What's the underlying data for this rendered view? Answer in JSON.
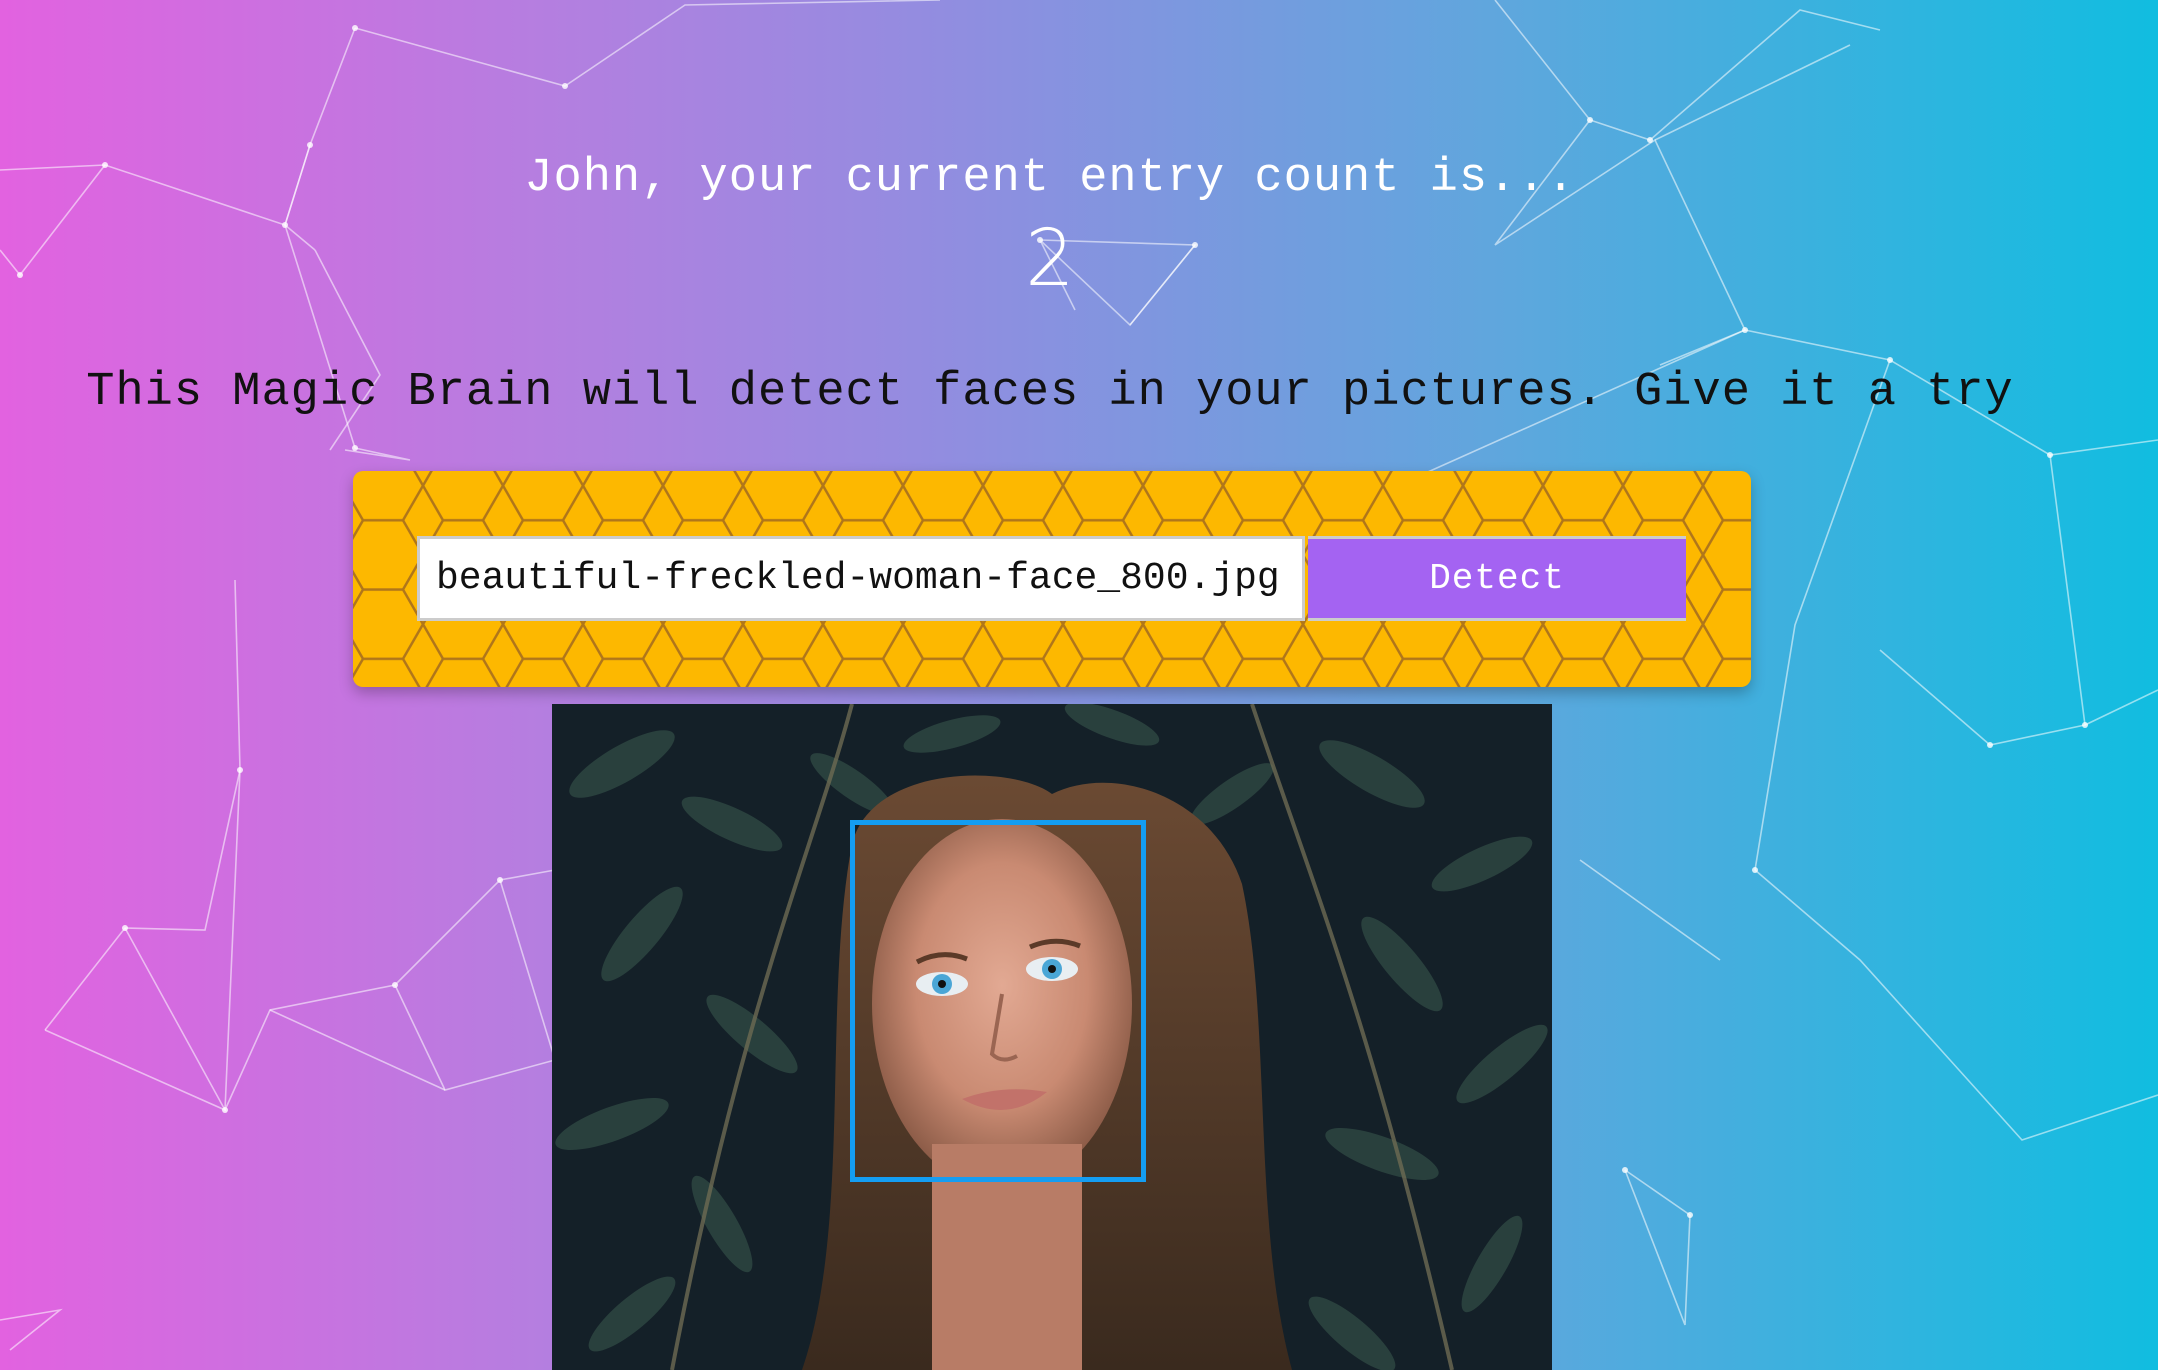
{
  "app": {
    "greeting": "John, your current entry count is...",
    "entry_count": "2",
    "intro": "This Magic Brain will detect faces in your pictures. Give it a try"
  },
  "form": {
    "image_url_value": "beautiful-freckled-woman-face_800.jpg",
    "detect_label": "Detect"
  },
  "colors": {
    "gradient_left": "#e262e0",
    "gradient_right": "#11bde0",
    "panel": "#fdb800",
    "button": "#a463f2",
    "face_box": "#149df2"
  },
  "icons": {
    "background": "particle-network",
    "panel_pattern": "honeycomb"
  }
}
